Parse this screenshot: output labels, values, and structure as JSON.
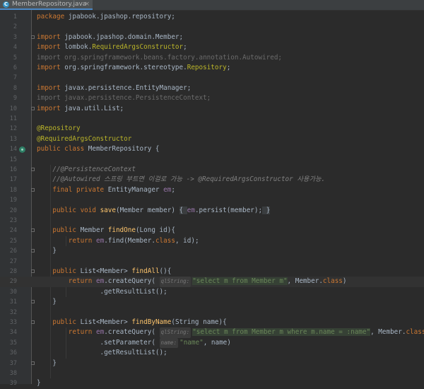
{
  "tab": {
    "title": "MemberRepository.java",
    "close": "×"
  },
  "lines": [
    {
      "n": "1",
      "html": "<span class=\"kw\">package</span> jpabook.jpashop.repository;"
    },
    {
      "n": "2",
      "html": ""
    },
    {
      "n": "3",
      "html": "<span class=\"kw\">import</span> jpabook.jpashop.domain.Member;"
    },
    {
      "n": "4",
      "html": "<span class=\"kw\">import</span> lombok.<span class=\"an\">RequiredArgsConstructor</span>;"
    },
    {
      "n": "5",
      "html": "<span class=\"dim\">import org.springframework.beans.factory.annotation.Autowired;</span>"
    },
    {
      "n": "6",
      "html": "<span class=\"kw\">import</span> org.springframework.stereotype.<span class=\"an\">Repository</span>;"
    },
    {
      "n": "7",
      "html": ""
    },
    {
      "n": "8",
      "html": "<span class=\"kw\">import</span> javax.persistence.EntityManager;"
    },
    {
      "n": "9",
      "html": "<span class=\"dim\">import javax.persistence.PersistenceContext;</span>"
    },
    {
      "n": "10",
      "html": "<span class=\"kw\">import</span> java.util.List;"
    },
    {
      "n": "11",
      "html": ""
    },
    {
      "n": "12",
      "html": "<span class=\"an\">@Repository</span>"
    },
    {
      "n": "13",
      "html": "<span class=\"an\">@RequiredArgsConstructor</span>"
    },
    {
      "n": "14",
      "html": "<span class=\"kw\">public class</span> MemberRepository {"
    },
    {
      "n": "15",
      "html": ""
    },
    {
      "n": "16",
      "html": "    <span class=\"cm\">//@PersistenceContext</span>"
    },
    {
      "n": "17",
      "html": "    <span class=\"cm\">//@Autowired 스프링 부트면 이걸로 가능 -&gt; @RequiredArgsConstructor 사용가능.</span>"
    },
    {
      "n": "18",
      "html": "    <span class=\"kw\">final private</span> EntityManager <span class=\"fl\">em</span>;"
    },
    {
      "n": "19",
      "html": ""
    },
    {
      "n": "20",
      "html": "    <span class=\"kw\">public void</span> <span class=\"fn\">save</span>(Member member) <span class=\"fold-inline\">{ </span><span class=\"fl\">em</span>.persist(member);<span class=\"fold-inline\"> }</span>"
    },
    {
      "n": "23",
      "html": ""
    },
    {
      "n": "24",
      "html": "    <span class=\"kw\">public</span> Member <span class=\"fn\">findOne</span>(Long id){"
    },
    {
      "n": "25",
      "html": "        <span class=\"kw\">return</span> <span class=\"fl\">em</span>.find(Member.<span class=\"kw\">class</span>, id);"
    },
    {
      "n": "26",
      "html": "    }"
    },
    {
      "n": "27",
      "html": ""
    },
    {
      "n": "28",
      "html": "    <span class=\"kw\">public</span> List&lt;Member&gt; <span class=\"fn\">findAll</span>(){"
    },
    {
      "n": "29",
      "html": "        <span class=\"kw\">return</span> <span class=\"fl\">em</span>.createQuery( <span class=\"hint\">qlString:</span><span class=\"st qs\">\"select m from Member m\"</span>, Member.<span class=\"kw\">class</span>)"
    },
    {
      "n": "30",
      "html": "                .getResultList();"
    },
    {
      "n": "31",
      "html": "    }"
    },
    {
      "n": "32",
      "html": ""
    },
    {
      "n": "33",
      "html": "    <span class=\"kw\">public</span> List&lt;Member&gt; <span class=\"fn\">findByName</span>(String name){"
    },
    {
      "n": "34",
      "html": "        <span class=\"kw\">return</span> <span class=\"fl\">em</span>.createQuery( <span class=\"hint\">qlString:</span><span class=\"st qs\">\"select m from Member m where m.name = :name\"</span>, Member.<span class=\"kw\">class</span>)"
    },
    {
      "n": "35",
      "html": "                .setParameter( <span class=\"hint\">name:</span><span class=\"st\">\"name\"</span>, name)"
    },
    {
      "n": "36",
      "html": "                .getResultList();"
    },
    {
      "n": "37",
      "html": "    }"
    },
    {
      "n": "38",
      "html": ""
    },
    {
      "n": "39",
      "html": "}"
    }
  ],
  "current_line": "29",
  "gutter_icon_line": "14",
  "gutter_icon": "bean-icon",
  "fold_markers": [
    "3",
    "10",
    "16",
    "18",
    "24",
    "26",
    "28",
    "31",
    "33",
    "37"
  ]
}
